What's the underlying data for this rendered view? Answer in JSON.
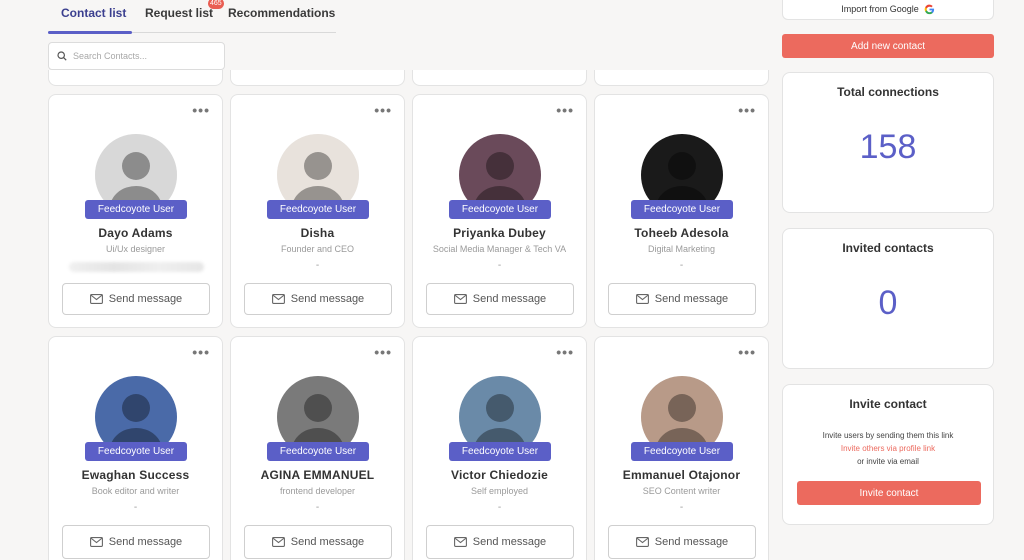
{
  "tabs": [
    {
      "label": "Contact list",
      "active": true
    },
    {
      "label": "Request list",
      "badge": "465"
    },
    {
      "label": "Recommendations"
    }
  ],
  "search": {
    "placeholder": "Search Contacts..."
  },
  "cards": [
    {
      "badge": "Feedcoyote User",
      "name": "Dayo Adams",
      "role": "Ui/Ux designer",
      "extra": "",
      "send": "Send message",
      "avatar_color": "#d8d8d8"
    },
    {
      "badge": "Feedcoyote User",
      "name": "Disha",
      "role": "Founder and CEO",
      "extra": "-",
      "send": "Send message",
      "avatar_color": "#e8e2dc"
    },
    {
      "badge": "Feedcoyote User",
      "name": "Priyanka Dubey",
      "role": "Social Media Manager & Tech VA",
      "extra": "-",
      "send": "Send message",
      "avatar_color": "#6a4a5a"
    },
    {
      "badge": "Feedcoyote User",
      "name": "Toheeb Adesola",
      "role": "Digital Marketing",
      "extra": "-",
      "send": "Send message",
      "avatar_color": "#1a1a1a"
    },
    {
      "badge": "Feedcoyote User",
      "name": "Ewaghan Success",
      "role": "Book editor and writer",
      "extra": "-",
      "send": "Send message",
      "avatar_color": "#4a6aa8"
    },
    {
      "badge": "Feedcoyote User",
      "name": "AGINA EMMANUEL",
      "role": "frontend developer",
      "extra": "-",
      "send": "Send message",
      "avatar_color": "#7a7a7a"
    },
    {
      "badge": "Feedcoyote User",
      "name": "Victor Chiedozie",
      "role": "Self employed",
      "extra": "-",
      "send": "Send message",
      "avatar_color": "#6a8aa8"
    },
    {
      "badge": "Feedcoyote User",
      "name": "Emmanuel Otajonor",
      "role": "SEO Content writer",
      "extra": "-",
      "send": "Send message",
      "avatar_color": "#b89a88"
    }
  ],
  "sidebar": {
    "import_label": "Import from Google",
    "add_label": "Add new contact",
    "total_title": "Total connections",
    "total_value": "158",
    "invited_title": "Invited contacts",
    "invited_value": "0",
    "invite_title": "Invite contact",
    "invite_line1": "Invite users by sending them this link",
    "invite_link": "Invite others via profile link",
    "invite_line3": "or invite via email",
    "invite_button": "Invite contact"
  },
  "colors": {
    "accent": "#5b5fc7",
    "danger": "#ec6a5e",
    "badge": "#e95d52"
  }
}
